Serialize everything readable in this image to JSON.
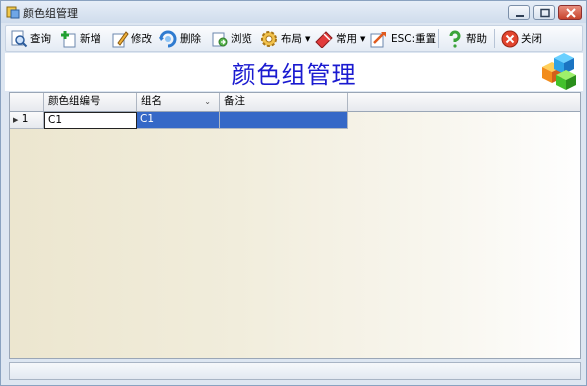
{
  "window": {
    "title": "颜色组管理"
  },
  "toolbar": {
    "query": "查询",
    "add": "新增",
    "edit": "修改",
    "delete": "删除",
    "browse": "浏览",
    "layout": "布局",
    "common": "常用",
    "reset": "ESC:重置",
    "help": "帮助",
    "close": "关闭"
  },
  "page": {
    "title": "颜色组管理"
  },
  "grid": {
    "columns": [
      "颜色组编号",
      "组名",
      "备注"
    ],
    "rows": [
      {
        "index": "1",
        "code": "C1",
        "name": "C1",
        "note": ""
      }
    ]
  },
  "colors": {
    "title": "#1a1ad0",
    "selection": "#3568c7"
  },
  "icons": [
    "app-icon",
    "minimize-icon",
    "maximize-icon",
    "close-window-icon",
    "search-icon",
    "add-icon",
    "edit-icon",
    "delete-icon",
    "browse-icon",
    "gear-icon",
    "common-icon",
    "reset-icon",
    "help-icon",
    "close-icon",
    "cubes-logo"
  ]
}
